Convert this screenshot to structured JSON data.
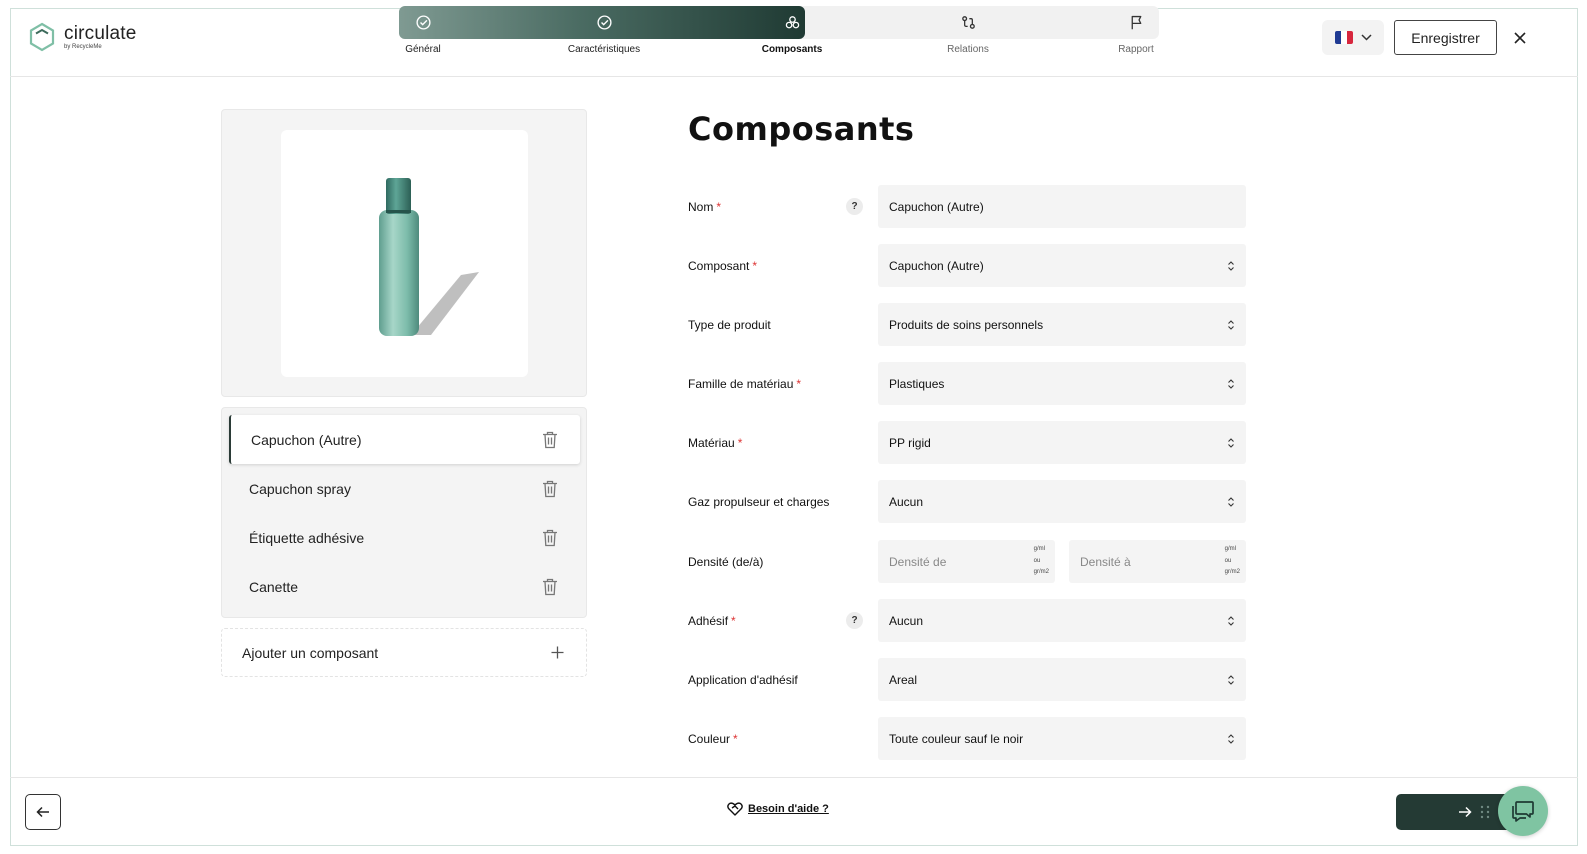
{
  "app": {
    "logo_main": "circulate",
    "logo_sub": "by RecycleMe"
  },
  "steps": [
    {
      "label": "Général",
      "icon": "check-circle-icon",
      "state": "done"
    },
    {
      "label": "Caractéristiques",
      "icon": "check-circle-icon",
      "state": "done"
    },
    {
      "label": "Composants",
      "icon": "components-icon",
      "state": "active"
    },
    {
      "label": "Relations",
      "icon": "relations-icon",
      "state": "pending"
    },
    {
      "label": "Rapport",
      "icon": "flag-icon",
      "state": "pending"
    }
  ],
  "header": {
    "language": "fr",
    "save_label": "Enregistrer"
  },
  "components": {
    "items": [
      {
        "label": "Capuchon (Autre)",
        "selected": true
      },
      {
        "label": "Capuchon spray",
        "selected": false
      },
      {
        "label": "Étiquette adhésive",
        "selected": false
      },
      {
        "label": "Canette",
        "selected": false
      }
    ],
    "add_label": "Ajouter un composant"
  },
  "form": {
    "title": "Composants",
    "nom": {
      "label": "Nom",
      "value": "Capuchon (Autre)",
      "required": true
    },
    "composant": {
      "label": "Composant",
      "value": "Capuchon (Autre)",
      "required": true
    },
    "type_produit": {
      "label": "Type de produit",
      "value": "Produits de soins personnels"
    },
    "famille": {
      "label": "Famille de matériau",
      "value": "Plastiques",
      "required": true
    },
    "materiau": {
      "label": "Matériau",
      "value": "PP rigid",
      "required": true
    },
    "gaz": {
      "label": "Gaz propulseur et charges",
      "value": "Aucun"
    },
    "densite": {
      "label": "Densité (de/à)",
      "from_placeholder": "Densité de",
      "to_placeholder": "Densité à",
      "unit_line1": "g/ml",
      "unit_line2": "ou",
      "unit_line3": "gr/m2"
    },
    "adhesif": {
      "label": "Adhésif",
      "value": "Aucun",
      "required": true
    },
    "application": {
      "label": "Application d'adhésif",
      "value": "Areal"
    },
    "couleur": {
      "label": "Couleur",
      "value": "Toute couleur sauf le noir",
      "required": true
    },
    "required_mark": "*"
  },
  "footer": {
    "help_label": "Besoin d'aide ?"
  },
  "colors": {
    "accent_dark": "#243a34",
    "chat": "#7fc4a2",
    "required": "#d33333"
  }
}
